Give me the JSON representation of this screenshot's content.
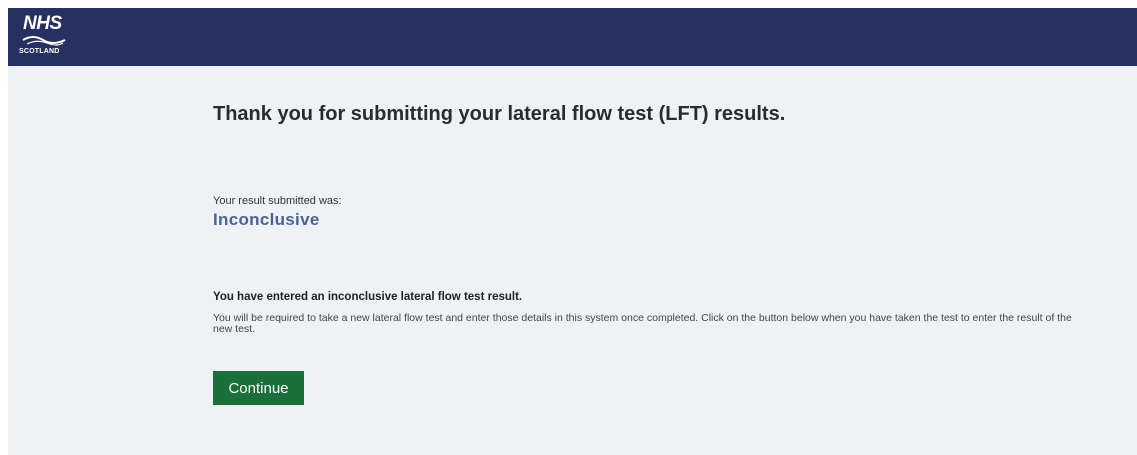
{
  "header": {
    "logo": {
      "brand": "NHS",
      "region": "SCOTLAND"
    },
    "background": "#263061"
  },
  "main": {
    "title": "Thank you for submitting your lateral flow test (LFT) results.",
    "result_label": "Your result submitted was:",
    "result_value": "Inconclusive",
    "message_heading": "You have entered an inconclusive lateral flow test result.",
    "message_body": "You will be required to take a new lateral flow test and enter those details in this system once completed. Click on the button below when you have taken the test to enter the result of the new test.",
    "continue_label": "Continue"
  },
  "colors": {
    "page_background": "#eef2f4",
    "accent_result": "#4a6491",
    "button": "#19703a"
  }
}
